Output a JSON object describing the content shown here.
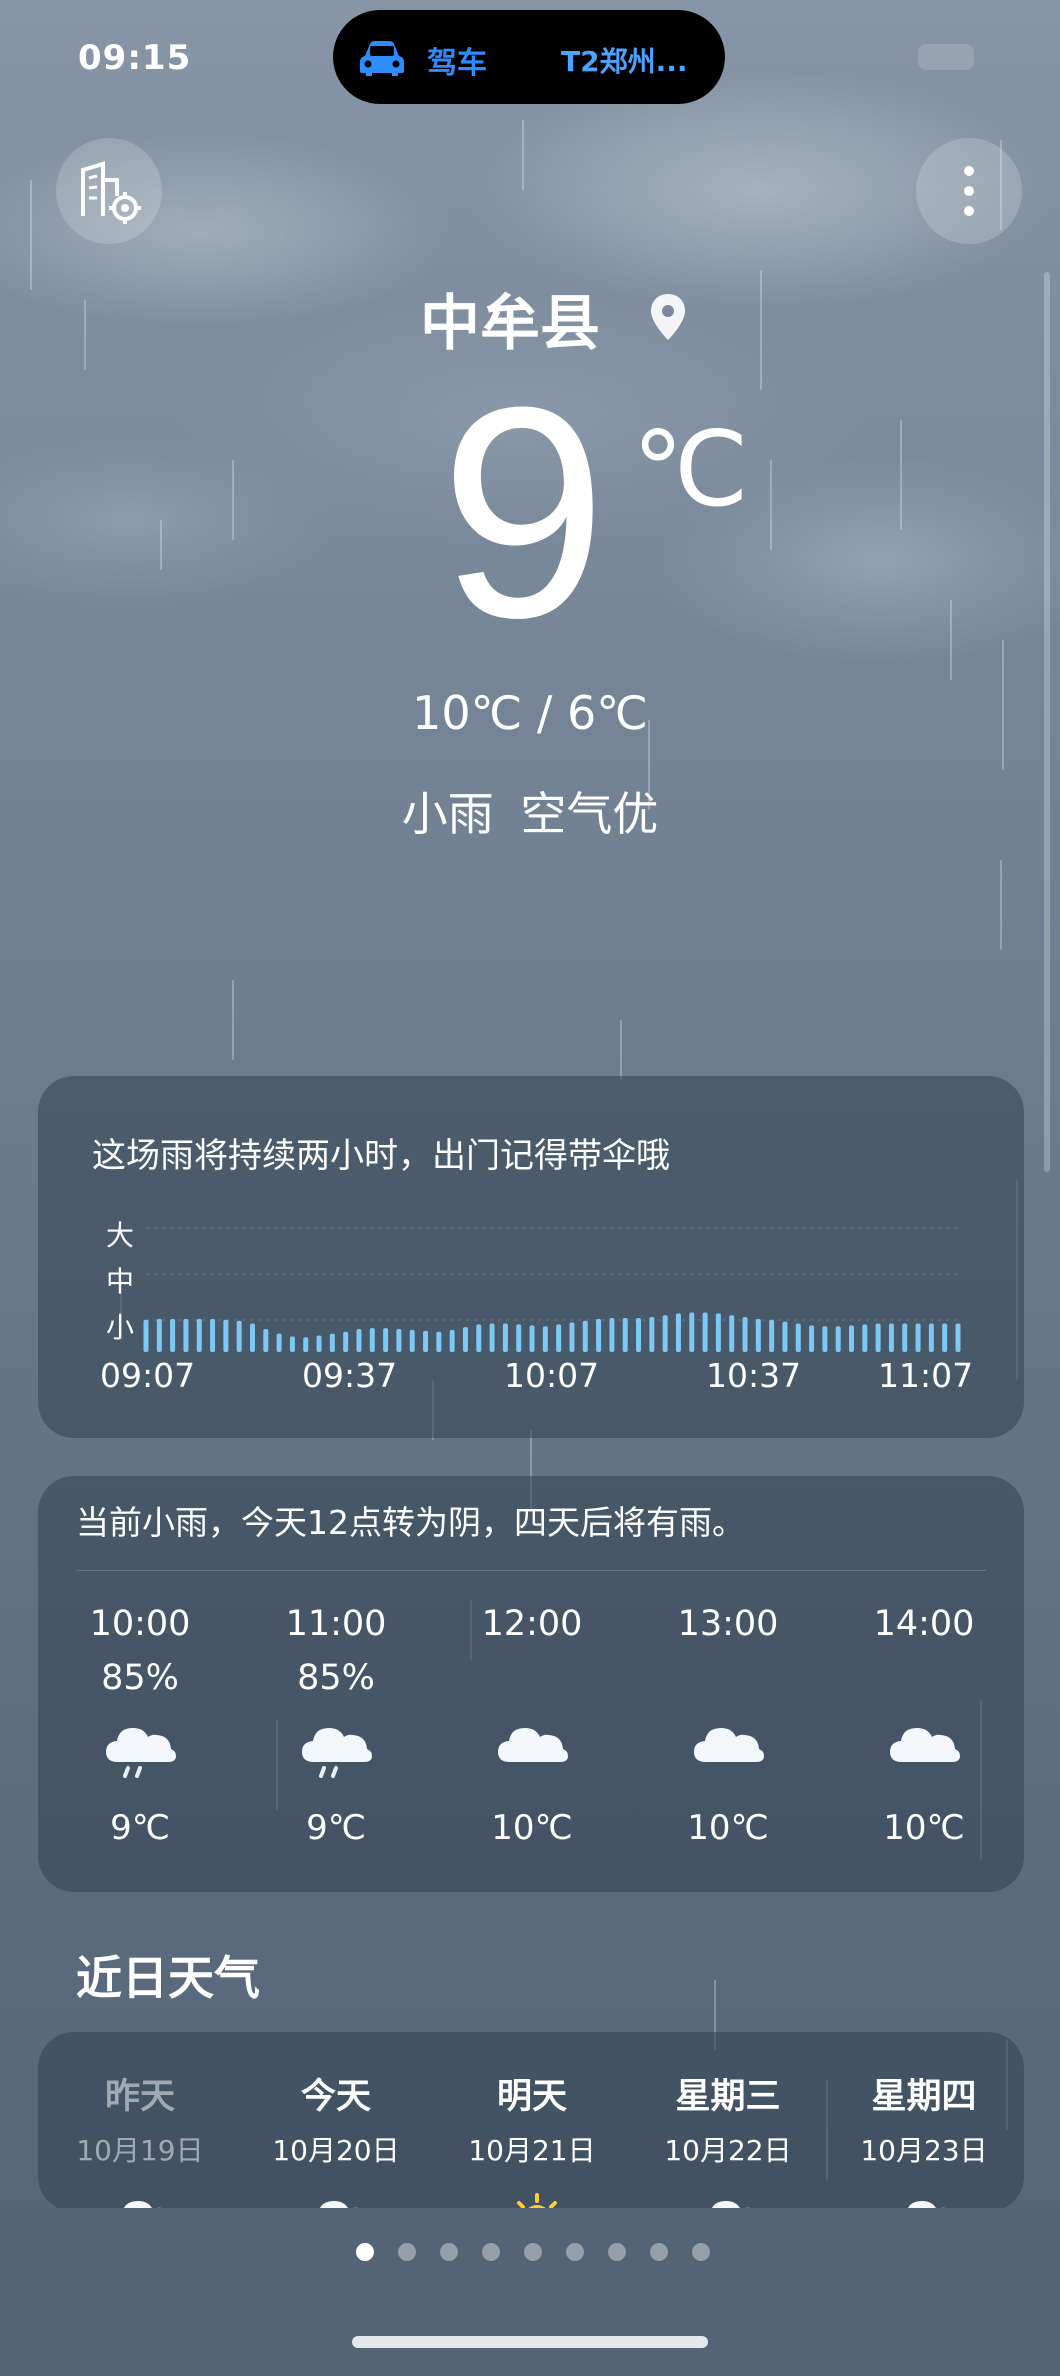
{
  "status": {
    "time": "09:15",
    "island_drive": "驾车",
    "island_dest": "T2郑州..."
  },
  "location": {
    "city": "中牟县"
  },
  "current": {
    "temp": "9",
    "unit": "℃",
    "range": "10℃ / 6℃",
    "condition": "小雨",
    "air": "空气优"
  },
  "rain_card": {
    "message": "这场雨将持续两小时，出门记得带伞哦",
    "levels": [
      "大",
      "中",
      "小"
    ],
    "ticks": [
      "09:07",
      "09:37",
      "10:07",
      "10:37",
      "11:07"
    ]
  },
  "chart_data": {
    "type": "bar",
    "ylabel": "",
    "ylim": [
      0,
      3
    ],
    "ylevels": [
      "小",
      "中",
      "大"
    ],
    "xticks": [
      "09:07",
      "09:37",
      "10:07",
      "10:37",
      "11:07"
    ],
    "values": [
      0.7,
      0.72,
      0.72,
      0.72,
      0.72,
      0.72,
      0.7,
      0.68,
      0.62,
      0.5,
      0.4,
      0.34,
      0.32,
      0.36,
      0.4,
      0.44,
      0.5,
      0.52,
      0.52,
      0.5,
      0.48,
      0.46,
      0.44,
      0.48,
      0.54,
      0.6,
      0.62,
      0.62,
      0.6,
      0.58,
      0.56,
      0.6,
      0.64,
      0.68,
      0.72,
      0.74,
      0.74,
      0.74,
      0.76,
      0.8,
      0.84,
      0.86,
      0.86,
      0.84,
      0.8,
      0.76,
      0.72,
      0.7,
      0.66,
      0.62,
      0.58,
      0.56,
      0.56,
      0.58,
      0.6,
      0.62,
      0.62,
      0.62,
      0.62,
      0.62,
      0.62,
      0.62
    ],
    "color": "#7ec8f5"
  },
  "hourly": {
    "summary": "当前小雨，今天12点转为阴，四天后将有雨。",
    "items": [
      {
        "time": "10:00",
        "precip": "85%",
        "icon": "rain-cloud-icon",
        "temp": "9℃"
      },
      {
        "time": "11:00",
        "precip": "85%",
        "icon": "rain-cloud-icon",
        "temp": "9℃"
      },
      {
        "time": "12:00",
        "precip": "",
        "icon": "cloud-icon",
        "temp": "10℃"
      },
      {
        "time": "13:00",
        "precip": "",
        "icon": "cloud-icon",
        "temp": "10℃"
      },
      {
        "time": "14:00",
        "precip": "",
        "icon": "cloud-icon",
        "temp": "10℃"
      }
    ]
  },
  "daily": {
    "title": "近日天气",
    "items": [
      {
        "name": "昨天",
        "date": "10月19日",
        "icon": "cloud-icon",
        "dim": true
      },
      {
        "name": "今天",
        "date": "10月20日",
        "icon": "cloud-icon",
        "dim": false
      },
      {
        "name": "明天",
        "date": "10月21日",
        "icon": "sun-cloud-icon",
        "dim": false
      },
      {
        "name": "星期三",
        "date": "10月22日",
        "icon": "cloud-icon",
        "dim": false
      },
      {
        "name": "星期四",
        "date": "10月23日",
        "icon": "cloud-icon",
        "dim": false
      }
    ]
  },
  "pager": {
    "count": 9,
    "active": 0
  },
  "colors": {
    "accent_blue": "#2f8cff",
    "rain_bar": "#7ec8f5"
  }
}
